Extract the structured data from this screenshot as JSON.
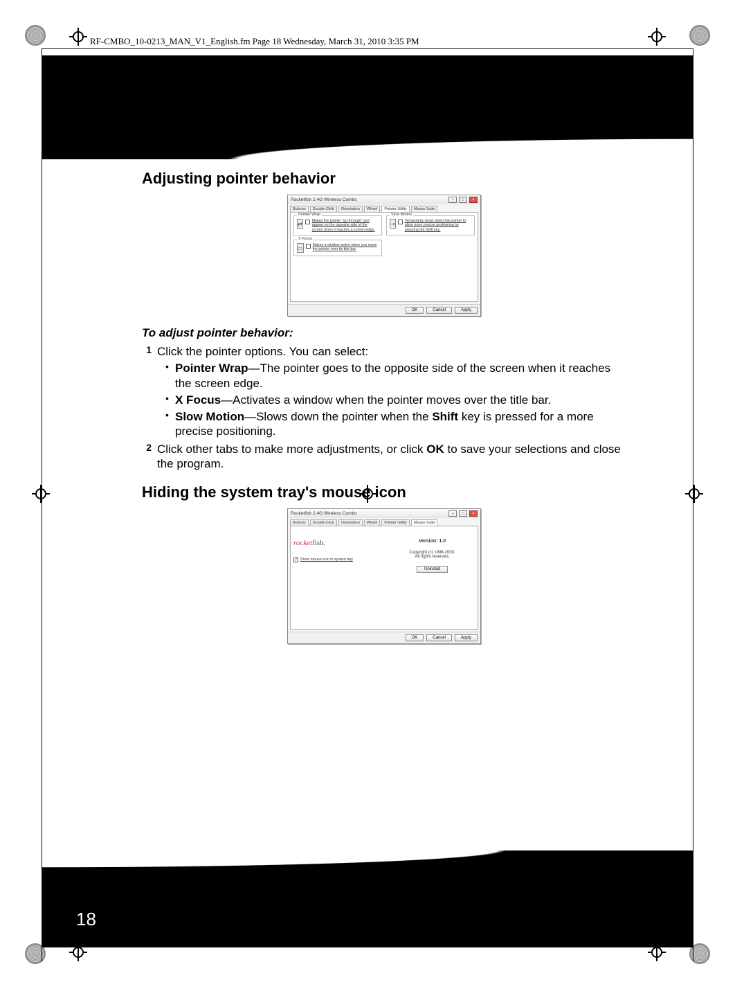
{
  "header_line": "RF-CMBO_10-0213_MAN_V1_English.fm  Page 18  Wednesday, March 31, 2010  3:35 PM",
  "page_number": "18",
  "h_adjust": "Adjusting pointer behavior",
  "h_adjust_sub": "To adjust pointer behavior:",
  "step1_num": "1",
  "step1_txt": "Click the pointer options. You can select:",
  "bullet_pw_label": "Pointer Wrap",
  "bullet_pw_txt": "—The pointer goes to the opposite side of the screen when it reaches the screen edge.",
  "bullet_xf_label": "X Focus",
  "bullet_xf_txt": "—Activates a window when the pointer moves over the title bar.",
  "bullet_sm_label": "Slow Motion",
  "bullet_sm_txt_a": "—Slows down the pointer when the ",
  "bullet_sm_shift": "Shift",
  "bullet_sm_txt_b": " key is pressed for a more precise positioning.",
  "step2_num": "2",
  "step2_txt_a": "Click other tabs to make more adjustments, or click ",
  "step2_ok": "OK",
  "step2_txt_b": " to save your selections and close the program.",
  "h_hide": "Hiding the system tray's mouse icon",
  "dlg": {
    "title": "Rocketfish 2.4G Wireless Combo",
    "tabs": [
      "Buttons",
      "Double-Click",
      "Orientation",
      "Wheel",
      "Pointer Utility",
      "Mouse Suite"
    ],
    "active_tab_1": 4,
    "active_tab_2": 5,
    "grp_pw": "Pointer Wrap",
    "grp_pw_txt": "Makes the pointer \"go through\" and appear on the opposite side of the screen when it reaches a screen edge.",
    "grp_sm": "Slow Motion",
    "grp_sm_txt": "Temporarily slows down the pointer to allow more precise positioning by pressing the Shift key.",
    "grp_xf": "X Focus",
    "grp_xf_txt": "Makes a window active when you move the pointer over its title bar.",
    "ok": "OK",
    "cancel": "Cancel",
    "apply": "Apply",
    "version": "Version: 1.0",
    "copyright": "Copyright (c) 1998-2003.\nAll rights reserved.",
    "uninstall": "Uninstall",
    "showicon": "Show mouse icon in system tray",
    "logo_a": "rocket",
    "logo_b": "fish"
  }
}
